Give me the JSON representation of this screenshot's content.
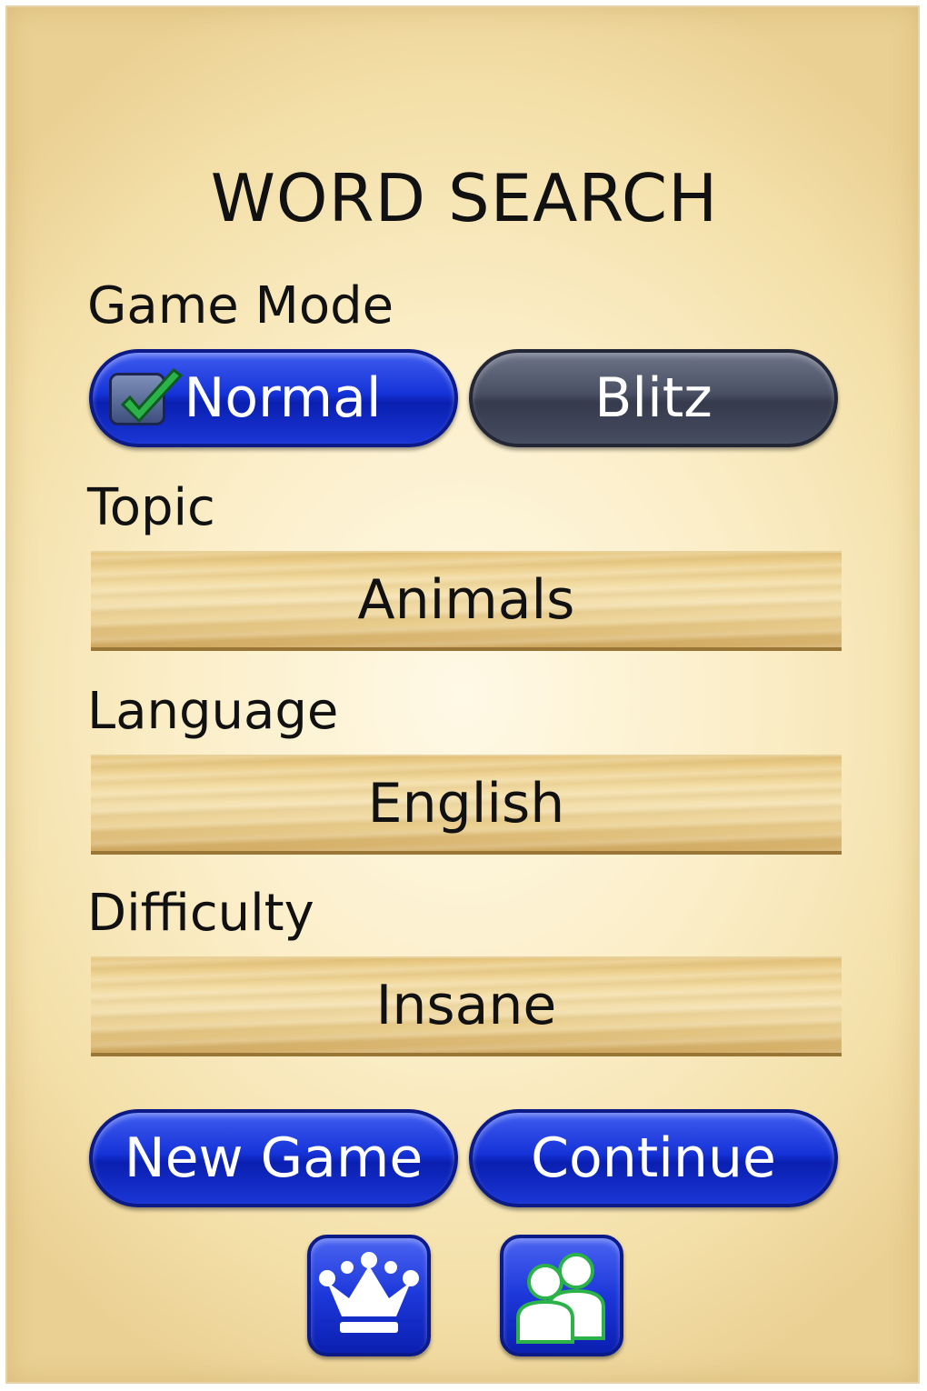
{
  "title": "WORD SEARCH",
  "game_mode": {
    "label": "Game Mode",
    "options": [
      {
        "label": "Normal",
        "selected": true
      },
      {
        "label": "Blitz",
        "selected": false
      }
    ]
  },
  "topic": {
    "label": "Topic",
    "value": "Animals"
  },
  "language": {
    "label": "Language",
    "value": "English"
  },
  "difficulty": {
    "label": "Difficulty",
    "value": "Insane"
  },
  "actions": {
    "new_game": "New Game",
    "continue": "Continue"
  },
  "icons": {
    "leaderboard": "crown-icon",
    "multiplayer": "people-icon"
  },
  "colors": {
    "selected_button": "#1633d8",
    "unselected_button": "#4a5064",
    "check": "#2bb34a",
    "background": "#fbeec8"
  }
}
